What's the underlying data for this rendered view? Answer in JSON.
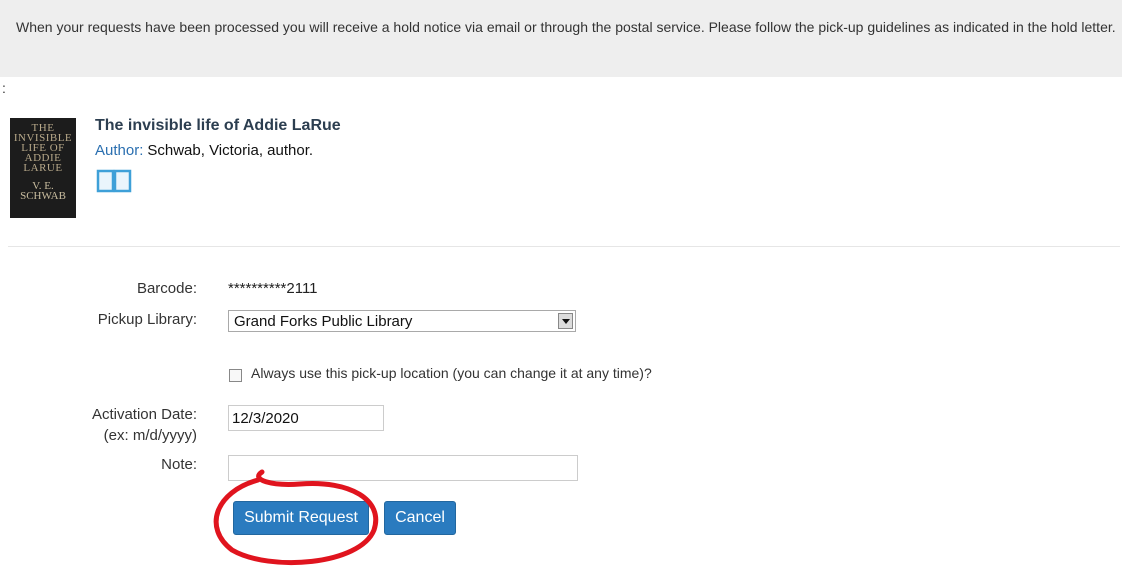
{
  "notice": {
    "text": "When your requests have been processed you will receive a hold notice via email or through the postal service. Please follow the pick-up guidelines as indicated in the hold letter."
  },
  "colon": ":",
  "book": {
    "title": "The invisible life of Addie LaRue",
    "author_label": "Author:",
    "author": "Schwab, Victoria, author.",
    "cover": {
      "title_lines": [
        "THE",
        "INVISIBLE",
        "LIFE OF",
        "ADDIE",
        "LARUE"
      ],
      "author_lines": [
        "V. E.",
        "SCHWAB"
      ]
    },
    "format_icon": "book-icon"
  },
  "form": {
    "barcode_label": "Barcode:",
    "barcode_value": "**********2111",
    "pickup_label": "Pickup Library:",
    "pickup_value": "Grand Forks Public Library",
    "always_use_label": "Always use this pick-up location (you can change it at any time)?",
    "activation_label": "Activation Date:",
    "activation_hint": "(ex: m/d/yyyy)",
    "activation_value": "12/3/2020",
    "note_label": "Note:",
    "note_value": ""
  },
  "buttons": {
    "submit": "Submit Request",
    "cancel": "Cancel"
  },
  "colors": {
    "button": "#2a7bbf",
    "annotation": "#e0141e",
    "notice_bg": "#eeeeee"
  }
}
